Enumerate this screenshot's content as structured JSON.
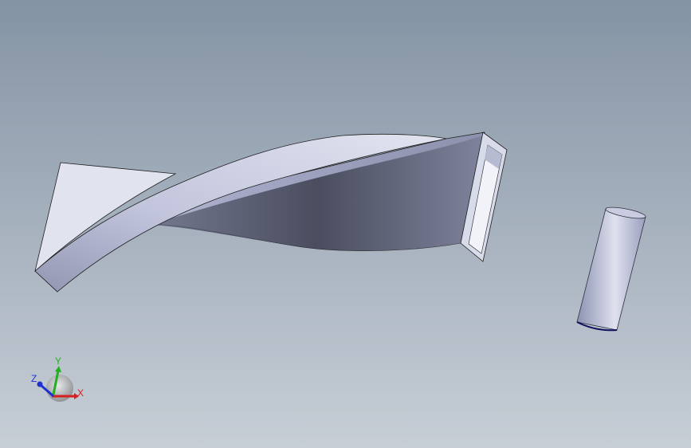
{
  "viewport": {
    "background_top": "#8493a4",
    "background_bottom": "#c7ced6"
  },
  "models": [
    {
      "name": "twisted-rectangular-duct",
      "color": "#b9bdd6"
    },
    {
      "name": "cylinder-part",
      "color": "#aab0cc"
    }
  ],
  "triad": {
    "x_label": "X",
    "y_label": "Y",
    "z_label": "Z",
    "x_color": "#d42020",
    "y_color": "#20b020",
    "z_color": "#2030d0"
  }
}
